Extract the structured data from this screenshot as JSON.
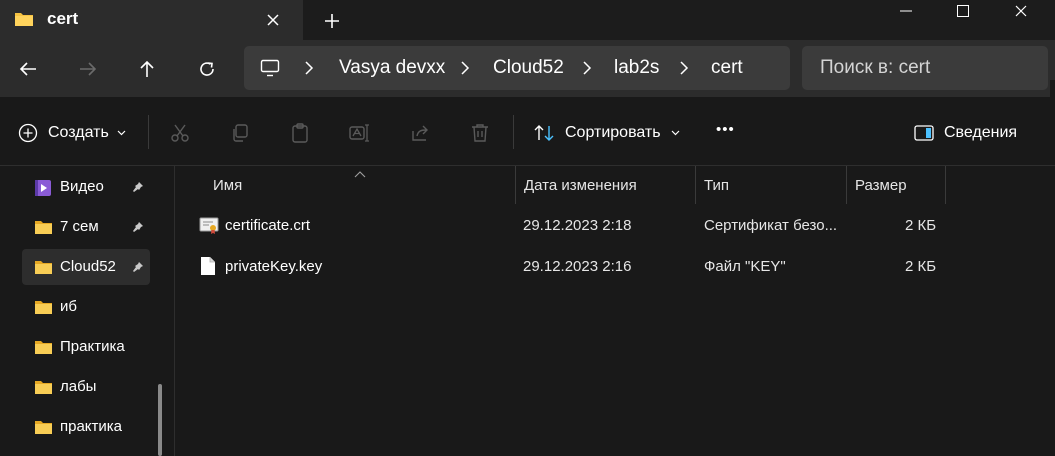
{
  "window": {
    "tab_title": "cert",
    "new_tab_symbol": "+"
  },
  "nav": {
    "breadcrumbs": [
      "Vasya devxx",
      "Cloud52",
      "lab2s",
      "cert"
    ],
    "search_placeholder": "Поиск в: cert"
  },
  "toolbar": {
    "create_label": "Создать",
    "sort_label": "Сортировать",
    "more_label": "•••",
    "details_label": "Сведения"
  },
  "sidebar": {
    "items": [
      {
        "label": "Видео",
        "icon": "video-folder-icon",
        "pinned": true
      },
      {
        "label": "7 сем",
        "icon": "folder-icon",
        "pinned": true
      },
      {
        "label": "Cloud52",
        "icon": "folder-icon",
        "pinned": true,
        "selected": true
      },
      {
        "label": "иб",
        "icon": "folder-icon",
        "pinned": false
      },
      {
        "label": "Практика",
        "icon": "folder-icon",
        "pinned": false
      },
      {
        "label": "лабы",
        "icon": "folder-icon",
        "pinned": false
      },
      {
        "label": "практика",
        "icon": "folder-icon",
        "pinned": false
      }
    ]
  },
  "file_list": {
    "columns": [
      "Имя",
      "Дата изменения",
      "Тип",
      "Размер"
    ],
    "rows": [
      {
        "name": "certificate.crt",
        "date": "29.12.2023 2:18",
        "type": "Сертификат безо...",
        "size": "2 КБ",
        "icon": "certificate-icon"
      },
      {
        "name": "privateKey.key",
        "date": "29.12.2023 2:16",
        "type": "Файл \"KEY\"",
        "size": "2 КБ",
        "icon": "file-icon"
      }
    ]
  },
  "colors": {
    "background": "#191919",
    "chrome": "#2c2c2c",
    "field": "#3b3b3b",
    "folder": "#f5c242",
    "accent": "#4cc2ff"
  }
}
